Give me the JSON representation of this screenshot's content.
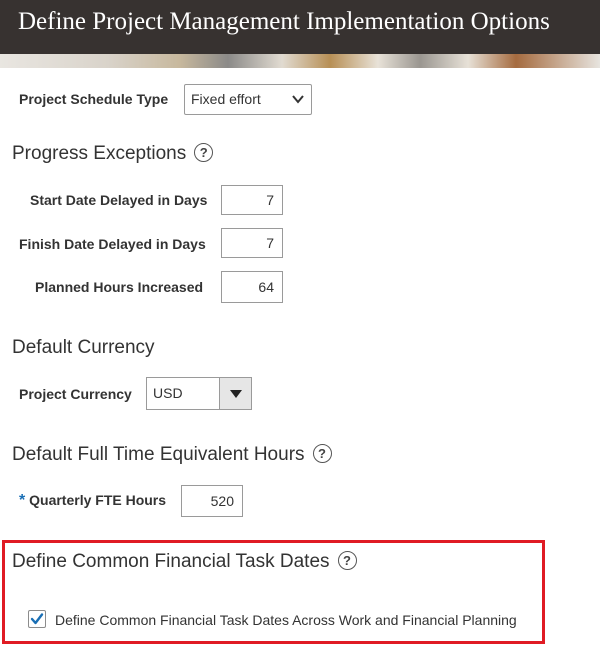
{
  "page_title": "Define Project Management Implementation Options",
  "schedule": {
    "label": "Project Schedule Type",
    "value": "Fixed effort"
  },
  "progress": {
    "heading": "Progress Exceptions",
    "start_label": "Start Date Delayed in Days",
    "start_value": "7",
    "finish_label": "Finish Date Delayed in Days",
    "finish_value": "7",
    "hours_label": "Planned Hours Increased",
    "hours_value": "64"
  },
  "currency": {
    "heading": "Default Currency",
    "label": "Project Currency",
    "value": "USD"
  },
  "fte": {
    "heading": "Default Full Time Equivalent Hours",
    "required_mark": "*",
    "label": "Quarterly FTE Hours",
    "value": "520"
  },
  "task_dates": {
    "heading": "Define Common Financial Task Dates",
    "checkbox_label": "Define Common Financial Task Dates Across Work and Financial Planning",
    "checked": true
  },
  "colors": {
    "highlight": "#e01b24",
    "checkmark": "#1a6fb5"
  }
}
